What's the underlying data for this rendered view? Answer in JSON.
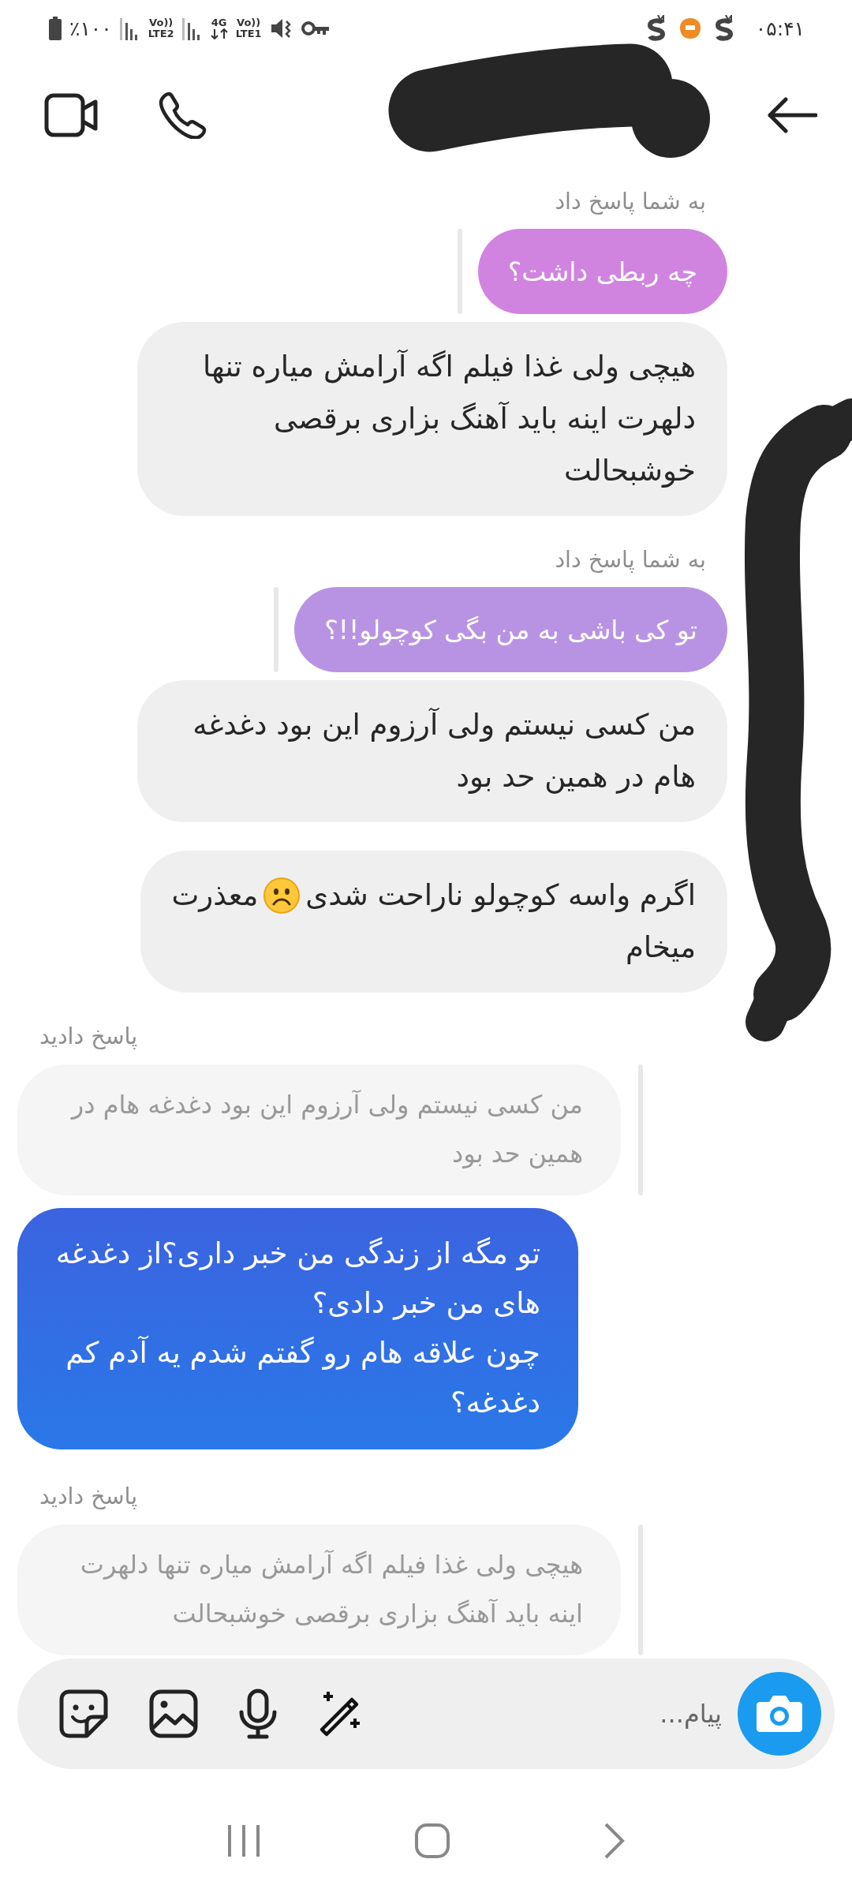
{
  "status_bar": {
    "battery": "٪۱۰۰",
    "sim2_top": "Vo))",
    "sim2_bottom": "LTE2",
    "network": "4G",
    "sim1_top": "Vo))",
    "sim1_bottom": "LTE1",
    "time": "۰۵:۴۱"
  },
  "thread": [
    {
      "kind": "reply_label_in",
      "text": "به شما پاسخ داد"
    },
    {
      "kind": "quote_in",
      "text": "چه ربطی داشت؟",
      "color": "#d084e0"
    },
    {
      "kind": "received",
      "text": "هیچی ولی غذا فیلم اگه آرامش میاره تنها دلهرت اینه باید آهنگ بزاری برقصی خوشبحالت"
    },
    {
      "kind": "reply_label_in",
      "text": "به شما پاسخ داد"
    },
    {
      "kind": "quote_in",
      "text": "تو کی باشی به من بگی کوچولو!!؟",
      "color": "#b993e3"
    },
    {
      "kind": "received",
      "text": "من کسی نیستم ولی آرزوم این بود دغدغه هام در همین حد بود"
    },
    {
      "kind": "received_emoji",
      "text": "اگرم واسه کوچولو ناراحت شدی",
      "text_after": "معذرت",
      "text_next_line": "میخام"
    },
    {
      "kind": "reply_label_out",
      "text": "پاسخ دادید"
    },
    {
      "kind": "quote_out",
      "text": "من کسی نیستم ولی آرزوم این بود دغدغه هام در همین حد بود"
    },
    {
      "kind": "sent",
      "text": "تو مگه از زندگی من خبر داری؟از دغدغه های من خبر دادی؟\nچون علاقه هام رو گفتم شدم یه آدم کم دغدغه؟"
    },
    {
      "kind": "reply_label_out",
      "text": "پاسخ دادید"
    },
    {
      "kind": "quote_out",
      "text": "هیچی ولی غذا فیلم اگه آرامش میاره تنها دلهرت اینه باید آهنگ بزاری برقصی خوشبحالت"
    }
  ],
  "composer": {
    "placeholder": "پیام..."
  }
}
